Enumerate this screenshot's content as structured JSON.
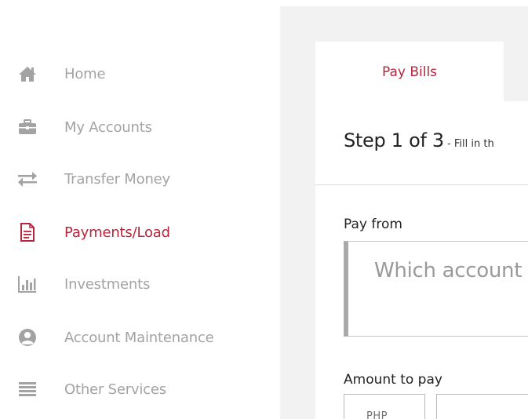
{
  "sidebar": {
    "items": [
      {
        "label": "Home",
        "icon": "home-icon",
        "active": false
      },
      {
        "label": "My Accounts",
        "icon": "briefcase-icon",
        "active": false
      },
      {
        "label": "Transfer Money",
        "icon": "transfer-arrows-icon",
        "active": false
      },
      {
        "label": "Payments/Load",
        "icon": "document-icon",
        "active": true
      },
      {
        "label": "Investments",
        "icon": "bar-chart-icon",
        "active": false
      },
      {
        "label": "Account Maintenance",
        "icon": "user-circle-icon",
        "active": false
      },
      {
        "label": "Other Services",
        "icon": "list-icon",
        "active": false
      }
    ]
  },
  "main": {
    "tab_label": "Pay Bills",
    "step_heading": "Step 1 of 3",
    "step_subtext": " - Fill in th",
    "pay_from": {
      "label": "Pay from",
      "placeholder": "Which account"
    },
    "amount": {
      "label": "Amount to pay",
      "currency": "PHP",
      "value": ""
    }
  },
  "colors": {
    "accent": "#b5253c",
    "muted_text": "#a3a3a3",
    "icon_gray": "#a3a3a3",
    "panel_bg": "#f2f2f2"
  }
}
